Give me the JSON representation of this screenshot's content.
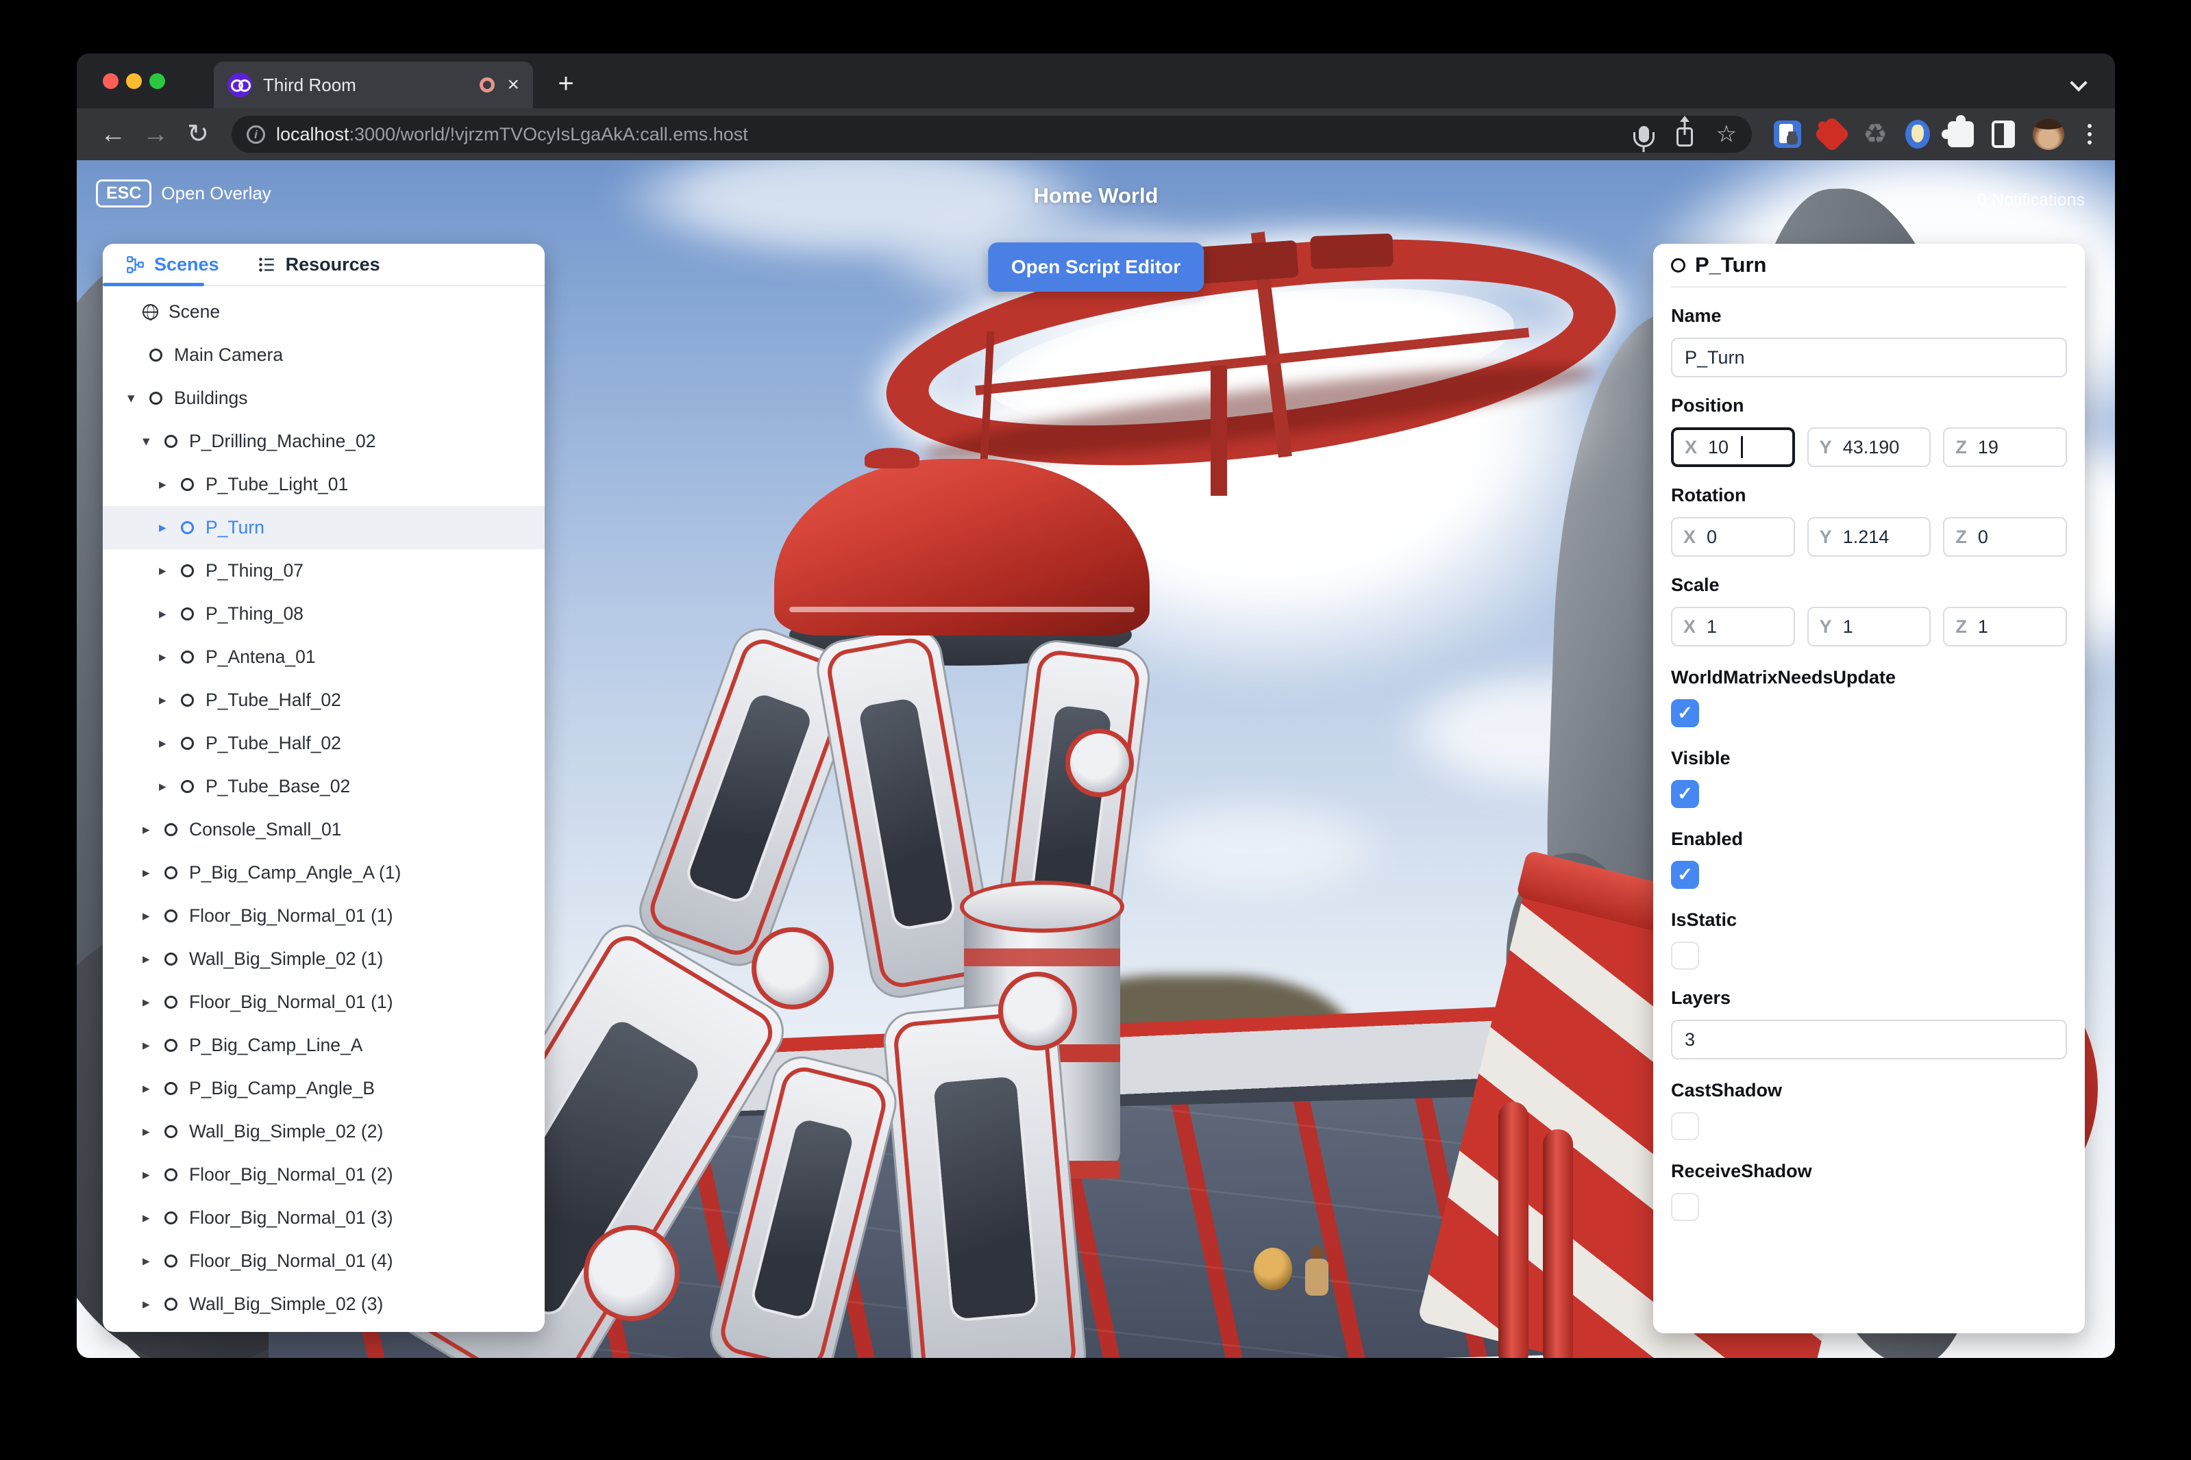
{
  "browser": {
    "tab": {
      "title": "Third Room"
    },
    "url": {
      "host": "localhost",
      "path": ":3000/world/!vjrzmTVOcyIsLgaAkA:call.ems.host"
    }
  },
  "hud": {
    "esc_key": "ESC",
    "open_overlay": "Open Overlay",
    "world_title": "Home World",
    "notifications": "0 Notifications",
    "open_script_editor": "Open Script Editor"
  },
  "left_panel": {
    "tabs": [
      {
        "label": "Scenes",
        "active": true
      },
      {
        "label": "Resources",
        "active": false
      }
    ],
    "tree": [
      {
        "label": "Scene",
        "level": 0,
        "icon": "globe",
        "arrow": null
      },
      {
        "label": "Main Camera",
        "level": 1,
        "icon": "circle",
        "arrow": null
      },
      {
        "label": "Buildings",
        "level": 1,
        "icon": "circle",
        "arrow": "down"
      },
      {
        "label": "P_Drilling_Machine_02",
        "level": 2,
        "icon": "circle",
        "arrow": "down"
      },
      {
        "label": "P_Tube_Light_01",
        "level": 3,
        "icon": "circle",
        "arrow": "right"
      },
      {
        "label": "P_Turn",
        "level": 3,
        "icon": "circle",
        "arrow": "right",
        "selected": true
      },
      {
        "label": "P_Thing_07",
        "level": 3,
        "icon": "circle",
        "arrow": "right"
      },
      {
        "label": "P_Thing_08",
        "level": 3,
        "icon": "circle",
        "arrow": "right"
      },
      {
        "label": "P_Antena_01",
        "level": 3,
        "icon": "circle",
        "arrow": "right"
      },
      {
        "label": "P_Tube_Half_02",
        "level": 3,
        "icon": "circle",
        "arrow": "right"
      },
      {
        "label": "P_Tube_Half_02",
        "level": 3,
        "icon": "circle",
        "arrow": "right"
      },
      {
        "label": "P_Tube_Base_02",
        "level": 3,
        "icon": "circle",
        "arrow": "right"
      },
      {
        "label": "Console_Small_01",
        "level": 2,
        "icon": "circle",
        "arrow": "right"
      },
      {
        "label": "P_Big_Camp_Angle_A (1)",
        "level": 2,
        "icon": "circle",
        "arrow": "right"
      },
      {
        "label": "Floor_Big_Normal_01 (1)",
        "level": 2,
        "icon": "circle",
        "arrow": "right"
      },
      {
        "label": "Wall_Big_Simple_02 (1)",
        "level": 2,
        "icon": "circle",
        "arrow": "right"
      },
      {
        "label": "Floor_Big_Normal_01 (1)",
        "level": 2,
        "icon": "circle",
        "arrow": "right"
      },
      {
        "label": "P_Big_Camp_Line_A",
        "level": 2,
        "icon": "circle",
        "arrow": "right"
      },
      {
        "label": "P_Big_Camp_Angle_B",
        "level": 2,
        "icon": "circle",
        "arrow": "right"
      },
      {
        "label": "Wall_Big_Simple_02 (2)",
        "level": 2,
        "icon": "circle",
        "arrow": "right"
      },
      {
        "label": "Floor_Big_Normal_01 (2)",
        "level": 2,
        "icon": "circle",
        "arrow": "right"
      },
      {
        "label": "Floor_Big_Normal_01 (3)",
        "level": 2,
        "icon": "circle",
        "arrow": "right"
      },
      {
        "label": "Floor_Big_Normal_01 (4)",
        "level": 2,
        "icon": "circle",
        "arrow": "right"
      },
      {
        "label": "Wall_Big_Simple_02 (3)",
        "level": 2,
        "icon": "circle",
        "arrow": "right"
      }
    ]
  },
  "inspector": {
    "title": "P_Turn",
    "axis_labels": [
      "X",
      "Y",
      "Z"
    ],
    "name": {
      "label": "Name",
      "value": "P_Turn"
    },
    "position": {
      "label": "Position",
      "x": "10",
      "y": "43.190",
      "z": "19"
    },
    "rotation": {
      "label": "Rotation",
      "x": "0",
      "y": "1.214",
      "z": "0"
    },
    "scale": {
      "label": "Scale",
      "x": "1",
      "y": "1",
      "z": "1"
    },
    "layers": {
      "label": "Layers",
      "value": "3"
    },
    "toggles": [
      {
        "label": "WorldMatrixNeedsUpdate",
        "checked": true
      },
      {
        "label": "Visible",
        "checked": true
      },
      {
        "label": "Enabled",
        "checked": true
      },
      {
        "label": "IsStatic",
        "checked": false
      },
      {
        "label": "CastShadow",
        "checked": false
      },
      {
        "label": "ReceiveShadow",
        "checked": false
      }
    ]
  },
  "colors": {
    "accent_blue": "#3b82f6",
    "button_blue": "#4a80e4",
    "checkbox_blue": "#4688f1",
    "selection_bg": "#edf0f5",
    "machine_red": "#c0392f"
  }
}
